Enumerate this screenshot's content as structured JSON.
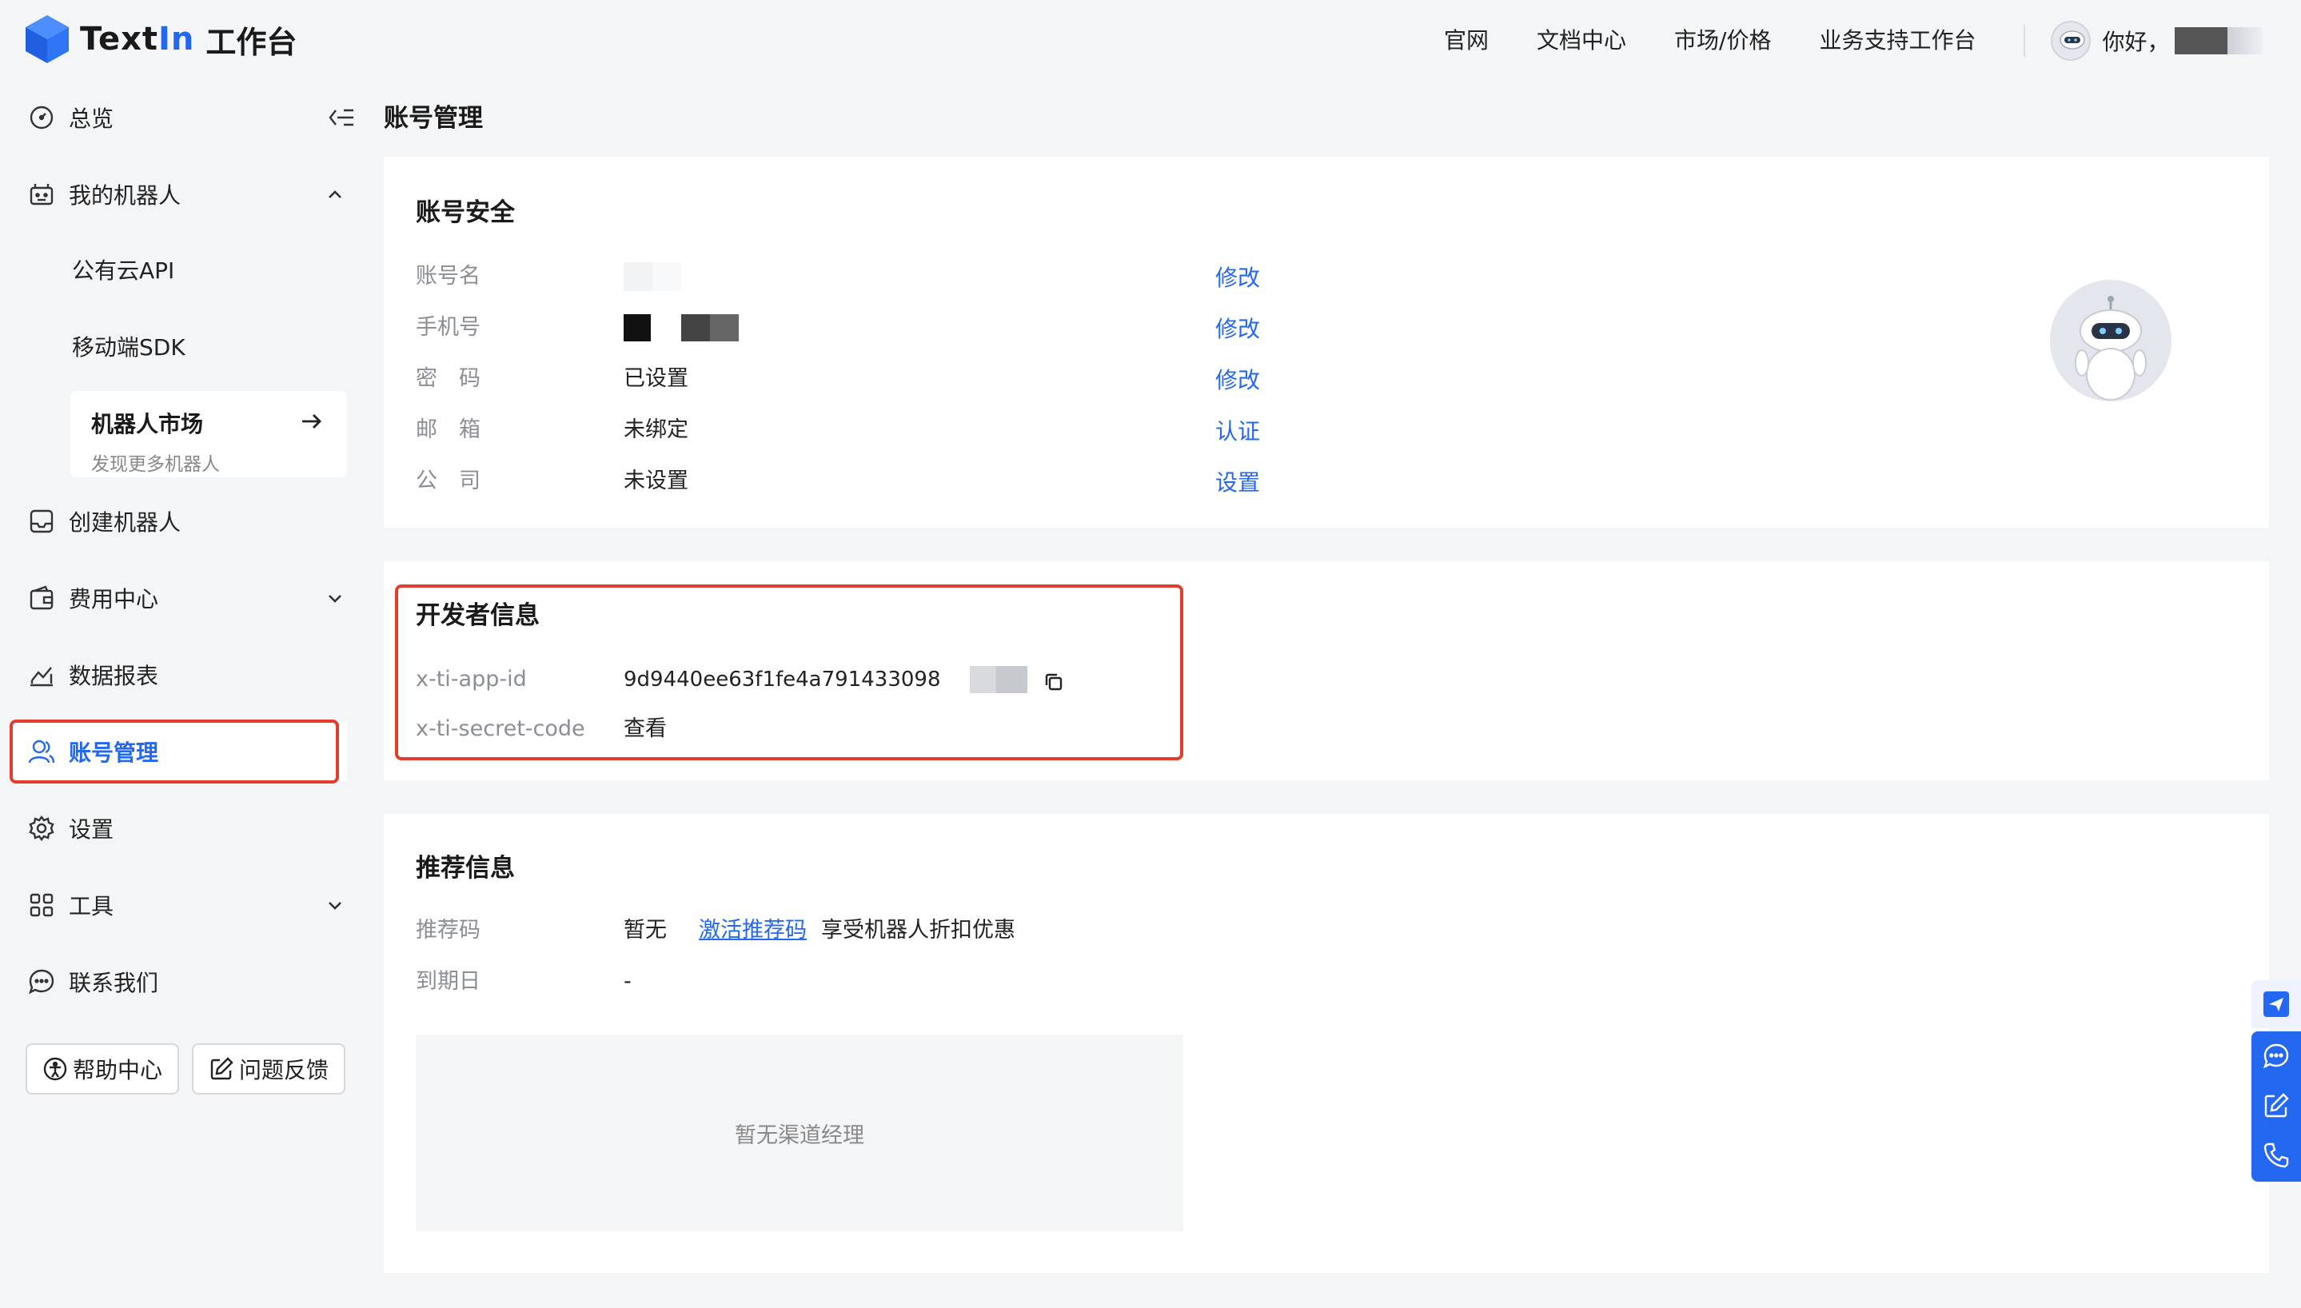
{
  "brand": {
    "name_prefix": "Text",
    "name_suffix": "In",
    "subtitle": "工作台"
  },
  "topnav": {
    "links": [
      "官网",
      "文档中心",
      "市场/价格",
      "业务支持工作台"
    ],
    "greeting": "你好，"
  },
  "sidebar": {
    "items": {
      "overview": "总览",
      "my_robots": "我的机器人",
      "public_api": "公有云API",
      "mobile_sdk": "移动端SDK",
      "market_title": "机器人市场",
      "market_desc": "发现更多机器人",
      "create_robot": "创建机器人",
      "billing": "费用中心",
      "reports": "数据报表",
      "account": "账号管理",
      "settings": "设置",
      "tools": "工具",
      "contact": "联系我们"
    },
    "buttons": {
      "help": "帮助中心",
      "feedback": "问题反馈"
    }
  },
  "page": {
    "title": "账号管理"
  },
  "security": {
    "title": "账号安全",
    "rows": [
      {
        "label": "账号名",
        "value": "",
        "action": "修改"
      },
      {
        "label": "手机号",
        "value": "",
        "action": "修改"
      },
      {
        "label": "密　码",
        "value": "已设置",
        "action": "修改"
      },
      {
        "label": "邮　箱",
        "value": "未绑定",
        "action": "认证"
      },
      {
        "label": "公　司",
        "value": "未设置",
        "action": "设置"
      }
    ]
  },
  "developer": {
    "title": "开发者信息",
    "app_id_label": "x-ti-app-id",
    "app_id_value": "9d9440ee63f1fe4a791433098",
    "secret_label": "x-ti-secret-code",
    "secret_action": "查看"
  },
  "referral": {
    "title": "推荐信息",
    "code_label": "推荐码",
    "code_value": "暂无",
    "activate_link": "激活推荐码",
    "activate_desc": "享受机器人折扣优惠",
    "expiry_label": "到期日",
    "expiry_value": "-",
    "manager_empty": "暂无渠道经理"
  },
  "colors": {
    "accent": "#2468f2",
    "success": "#2bb673",
    "highlight": "#e23d2d"
  },
  "icons": [
    "gauge-icon",
    "robot-icon",
    "inbox-icon",
    "wallet-icon",
    "chart-icon",
    "users-icon",
    "gear-icon",
    "grid-icon",
    "chat-icon",
    "copy-icon",
    "send-icon",
    "edit-icon",
    "phone-icon"
  ]
}
